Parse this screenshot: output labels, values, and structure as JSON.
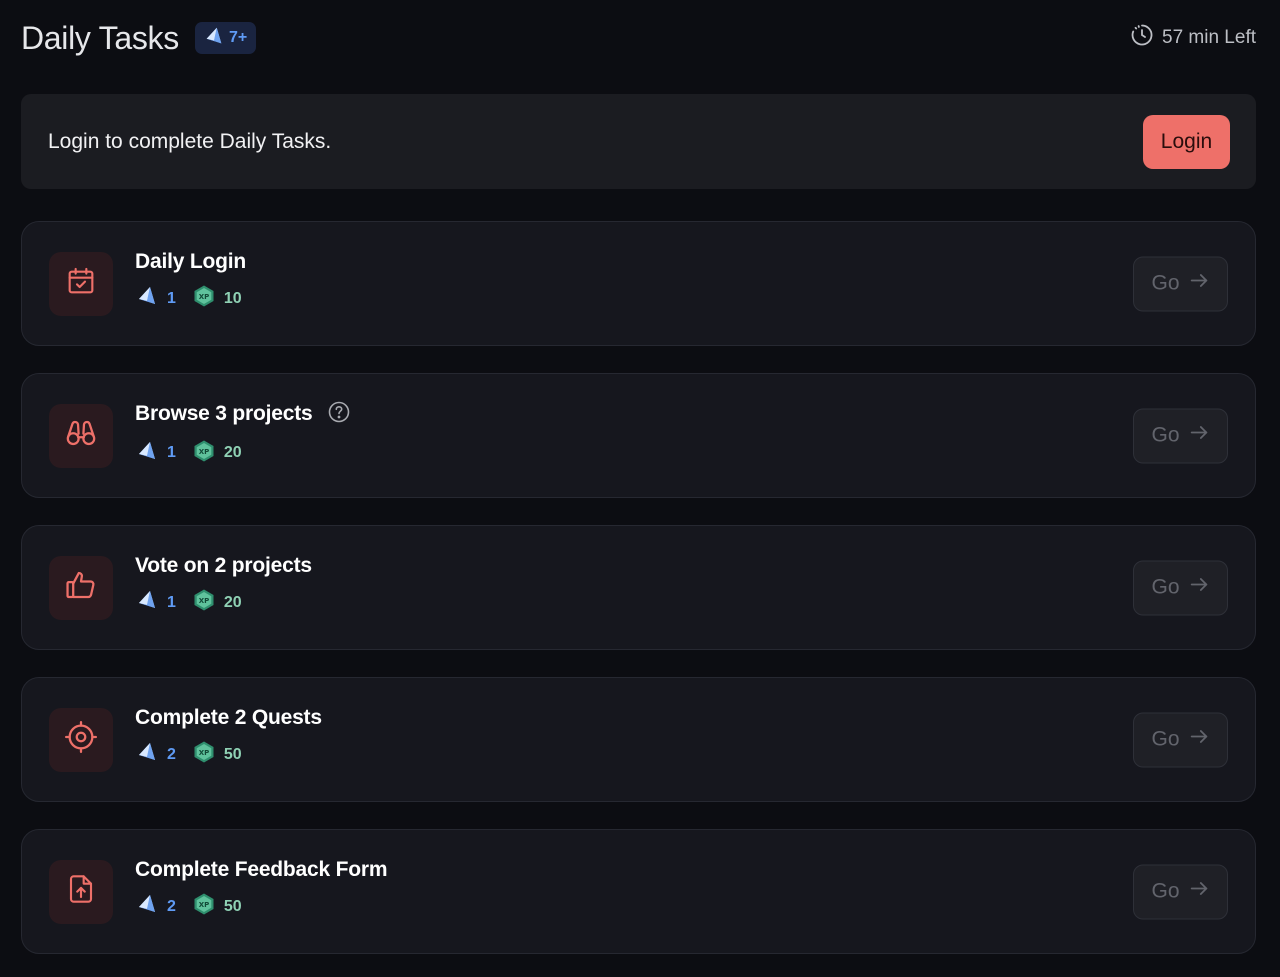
{
  "header": {
    "title": "Daily Tasks",
    "badge": "7+",
    "timer": "57 min Left"
  },
  "login_banner": {
    "message": "Login to complete Daily Tasks.",
    "button": "Login"
  },
  "tasks": [
    {
      "title": "Daily Login",
      "icon": "calendar-check-icon",
      "gems": "1",
      "xp": "10",
      "go": "Go"
    },
    {
      "title": "Browse 3 projects",
      "icon": "binoculars-icon",
      "gems": "1",
      "xp": "20",
      "go": "Go",
      "help": true
    },
    {
      "title": "Vote on 2 projects",
      "icon": "thumbs-up-icon",
      "gems": "1",
      "xp": "20",
      "go": "Go"
    },
    {
      "title": "Complete 2 Quests",
      "icon": "crosshair-icon",
      "gems": "2",
      "xp": "50",
      "go": "Go"
    },
    {
      "title": "Complete Feedback Form",
      "icon": "file-upload-icon",
      "gems": "2",
      "xp": "50",
      "go": "Go"
    }
  ],
  "colors": {
    "accent": "#ee7069",
    "gem": "#5f9bf5",
    "xp": "#8fd1b4",
    "background": "#0c0d12",
    "card": "#16171e"
  }
}
